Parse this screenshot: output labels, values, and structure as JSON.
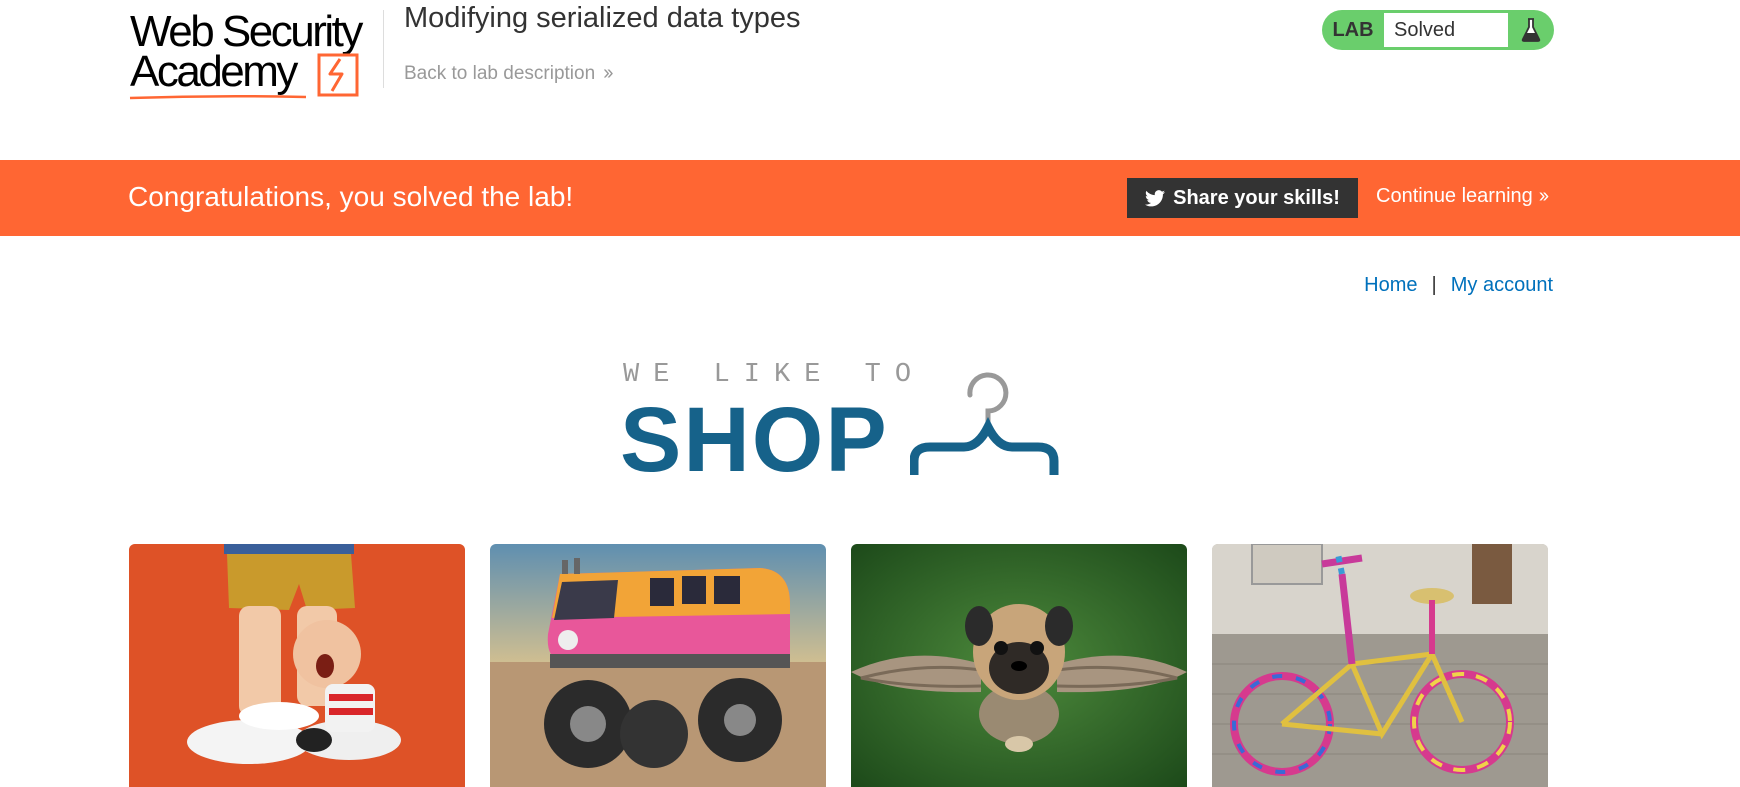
{
  "header": {
    "logo": {
      "line1": "Web Security",
      "line2": "Academy"
    },
    "lab_title": "Modifying serialized data types",
    "back_link": "Back to lab description",
    "lab_badge": {
      "tag": "LAB",
      "state": "Solved",
      "icon": "flask-icon"
    }
  },
  "banner": {
    "message": "Congratulations, you solved the lab!",
    "share_button": "Share your skills!",
    "share_icon": "twitter-icon",
    "continue_link": "Continue learning"
  },
  "nav": {
    "home": "Home",
    "separator": "|",
    "account": "My account"
  },
  "shop_logo": {
    "tagline": "WE LIKE TO",
    "word": "SHOP",
    "icon": "hanger-icon"
  },
  "products": [
    {
      "image": "figurine-child-clinging-to-leg"
    },
    {
      "image": "pink-monster-truck-van"
    },
    {
      "image": "pug-with-wings"
    },
    {
      "image": "yarn-wrapped-bicycle"
    }
  ],
  "colors": {
    "banner": "#ff6633",
    "lab_solved": "#6ace6c",
    "link": "#0071bc",
    "shop_blue": "#16628a"
  }
}
